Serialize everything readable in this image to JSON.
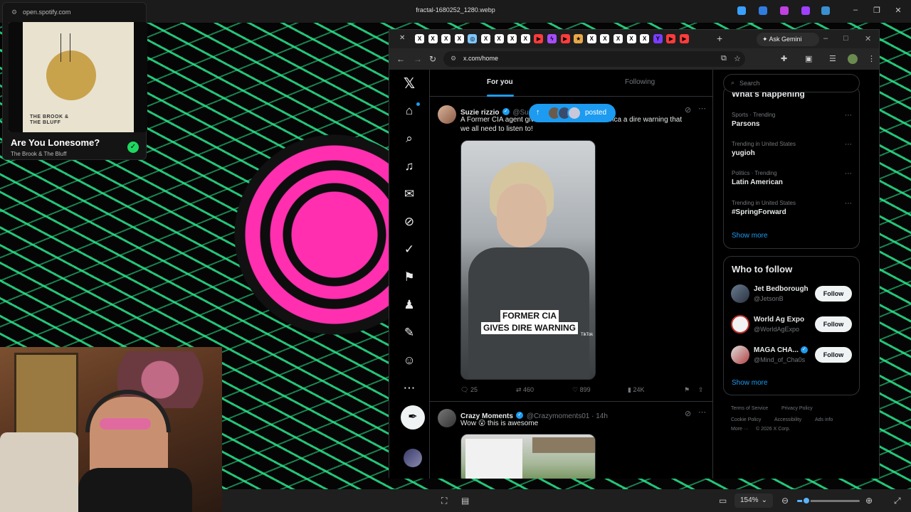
{
  "viewer": {
    "title": "fractal-1680252_1280.webp",
    "zoom": "154%",
    "zoom_fraction": 0.15
  },
  "spotify": {
    "url": "open.spotify.com",
    "album_art_text": "THE BROOK &\nTHE BLUFF",
    "track_title": "Are You Lonesome?",
    "artist": "The Brook & The Bluff"
  },
  "browser": {
    "url": "x.com/home",
    "gemini_label": "Ask Gemini",
    "tab_colors": [
      "#ffffff",
      "#ffffff",
      "#ffffff",
      "#ffffff",
      "#7fc7ff",
      "#ffffff",
      "#ffffff",
      "#ffffff",
      "#ffffff",
      "#ff3b3b",
      "#a64dff",
      "#ff3b3b",
      "#e8a94a",
      "#ffffff",
      "#ffffff",
      "#ffffff",
      "#ffffff",
      "#ffffff",
      "#7a3dff",
      "#ff3b3b",
      "#ff3b3b"
    ],
    "tab_icons": [
      "x-icon",
      "x-icon",
      "x-icon",
      "x-icon",
      "globe-icon",
      "x-icon",
      "x-icon",
      "x-icon",
      "x-icon",
      "youtube-icon",
      "twitch-icon",
      "youtube-icon",
      "bookmark-icon",
      "x-icon",
      "x-icon",
      "x-icon",
      "x-icon",
      "x-icon",
      "yahoo-icon",
      "youtube-icon",
      "youtube-icon"
    ]
  },
  "x": {
    "tabs": {
      "for_you": "For you",
      "following": "Following"
    },
    "posted_pill": "posted",
    "posts": [
      {
        "name": "Suzie rizzio",
        "handle": "@Suz",
        "text_line1": "A Former CIA agent giv",
        "text_line1b": "America a dire warning that",
        "text_line2": "we all need to listen to!",
        "media_caption_1": "FORMER CIA",
        "media_caption_2": "GIVES DIRE WARNING",
        "media_watermark": "TikTok",
        "replies": "25",
        "reposts": "460",
        "likes": "899",
        "views": "24K"
      },
      {
        "name": "Crazy Moments",
        "handle": "@Crazymoments01 · 14h",
        "text": "Wow 😮 this is awesome"
      }
    ],
    "search_placeholder": "Search",
    "whats_happening": "What's happening",
    "trends": [
      {
        "meta": "Sports · Trending",
        "name": "Parsons"
      },
      {
        "meta": "Trending in United States",
        "name": "yugioh"
      },
      {
        "meta": "Politics · Trending",
        "name": "Latin American"
      },
      {
        "meta": "Trending in United States",
        "name": "#SpringForward"
      }
    ],
    "show_more": "Show more",
    "who_to_follow": "Who to follow",
    "follow_label": "Follow",
    "suggestions": [
      {
        "name": "Jet Bedborough",
        "handle": "@JetsonB"
      },
      {
        "name": "World Ag Expo",
        "handle": "@WorldAgExpo"
      },
      {
        "name": "MAGA CHA...",
        "handle": "@Mind_of_Cha0s"
      }
    ],
    "footer": {
      "terms": "Terms of Service",
      "privacy": "Privacy Policy",
      "cookie": "Cookie Policy",
      "accessibility": "Accessibility",
      "ads": "Ads info",
      "more": "More ···",
      "copyright": "© 2026 X Corp."
    }
  }
}
